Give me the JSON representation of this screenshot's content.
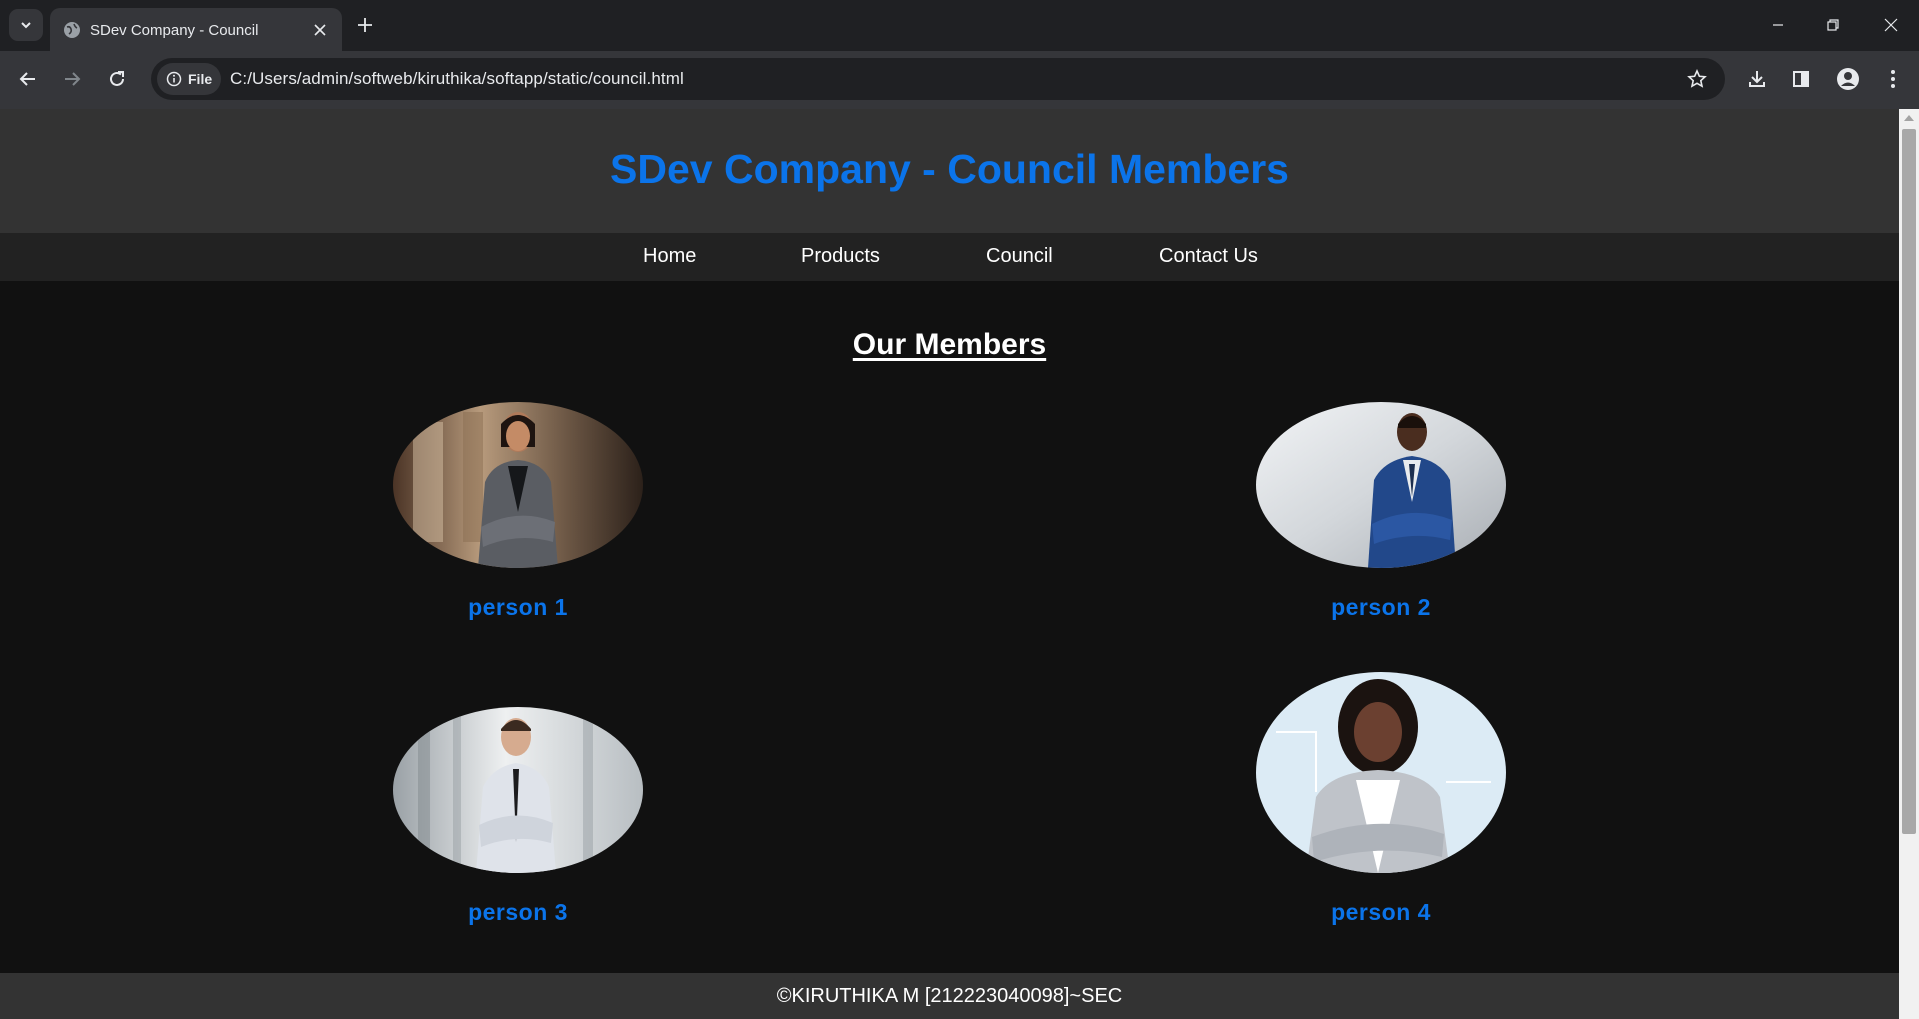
{
  "browser": {
    "tab_title": "SDev Company - Council",
    "chip_label": "File",
    "url": "C:/Users/admin/softweb/kiruthika/softapp/static/council.html"
  },
  "header": {
    "title": "SDev Company - Council Members"
  },
  "nav": {
    "home": "Home",
    "products": "Products",
    "council": "Council",
    "contact": "Contact Us"
  },
  "section_title": "Our Members",
  "members": [
    {
      "name": "person 1"
    },
    {
      "name": "person 2"
    },
    {
      "name": "person 3"
    },
    {
      "name": "person 4"
    }
  ],
  "footer": {
    "text": "©KIRUTHIKA M [212223040098]~SEC"
  },
  "colors": {
    "accent": "#0b74ea",
    "header_bg": "#333333",
    "nav_bg": "#222222",
    "page_bg": "#111111"
  }
}
